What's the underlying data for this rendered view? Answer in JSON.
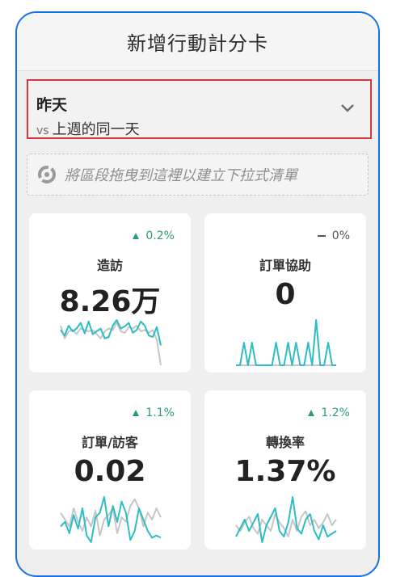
{
  "header": {
    "title": "新增行動計分卡"
  },
  "date_range": {
    "selected": "昨天",
    "compare_prefix": "vs",
    "compare_label": "上週的同一天"
  },
  "dropzone": {
    "placeholder": "將區段拖曳到這裡以建立下拉式清單"
  },
  "colors": {
    "accent": "#2dbdc2",
    "comparison": "#c6c6c6",
    "positive": "#2d9d78",
    "highlight_border": "#d7373f",
    "frame": "#1473e6"
  },
  "cards": [
    {
      "label": "造訪",
      "value": "8.26万",
      "delta": "0.2%",
      "trend": "up",
      "current": [
        60,
        52,
        66,
        58,
        62,
        70,
        55,
        72,
        54,
        58,
        62,
        48,
        50,
        66,
        74,
        62,
        65,
        70,
        56,
        60,
        72,
        66,
        52,
        50,
        64,
        38
      ],
      "comparison": [
        66,
        48,
        58,
        60,
        54,
        62,
        60,
        58,
        60,
        54,
        48,
        58,
        62,
        60,
        70,
        58,
        56,
        64,
        62,
        66,
        58,
        60,
        56,
        60,
        46,
        10
      ]
    },
    {
      "label": "訂單協助",
      "value": "0",
      "delta": "0%",
      "trend": "flat",
      "current": [
        0,
        0,
        1,
        0,
        1,
        0,
        0,
        0,
        0,
        0,
        1,
        0,
        0,
        1,
        0,
        1,
        0,
        0,
        1,
        0,
        2,
        0,
        0,
        1,
        0,
        0
      ],
      "comparison": [
        0,
        0,
        0,
        0,
        0,
        0,
        0,
        0,
        0,
        0,
        0,
        0,
        0,
        0,
        0,
        0,
        0,
        0,
        0,
        0,
        0,
        0,
        0,
        0,
        0,
        0
      ]
    },
    {
      "label": "訂單/訪客",
      "value": "0.02",
      "delta": "1.1%",
      "trend": "up",
      "current": [
        0.022,
        0.024,
        0.019,
        0.027,
        0.021,
        0.03,
        0.018,
        0.015,
        0.026,
        0.028,
        0.035,
        0.022,
        0.031,
        0.024,
        0.033,
        0.028,
        0.016,
        0.02,
        0.03,
        0.025,
        0.02,
        0.017,
        0.018,
        0.017
      ],
      "comparison": [
        0.028,
        0.025,
        0.022,
        0.03,
        0.024,
        0.02,
        0.026,
        0.022,
        0.029,
        0.018,
        0.025,
        0.027,
        0.03,
        0.019,
        0.026,
        0.024,
        0.031,
        0.034,
        0.03,
        0.022,
        0.028,
        0.025,
        0.03,
        0.026
      ]
    },
    {
      "label": "轉換率",
      "value": "1.37%",
      "delta": "1.2%",
      "trend": "up",
      "current": [
        1.2,
        1.35,
        1.5,
        1.3,
        1.45,
        1.6,
        1.1,
        1.4,
        1.55,
        1.7,
        1.3,
        1.2,
        1.45,
        1.9,
        1.35,
        1.25,
        1.5,
        1.6,
        1.3,
        1.15,
        1.4,
        1.2,
        1.25,
        1.3
      ],
      "comparison": [
        1.4,
        1.3,
        1.45,
        1.55,
        1.35,
        1.25,
        1.5,
        1.4,
        1.3,
        1.6,
        1.45,
        1.35,
        1.2,
        1.5,
        1.3,
        1.55,
        1.65,
        1.4,
        1.5,
        1.35,
        1.45,
        1.6,
        1.4,
        1.5
      ]
    }
  ]
}
